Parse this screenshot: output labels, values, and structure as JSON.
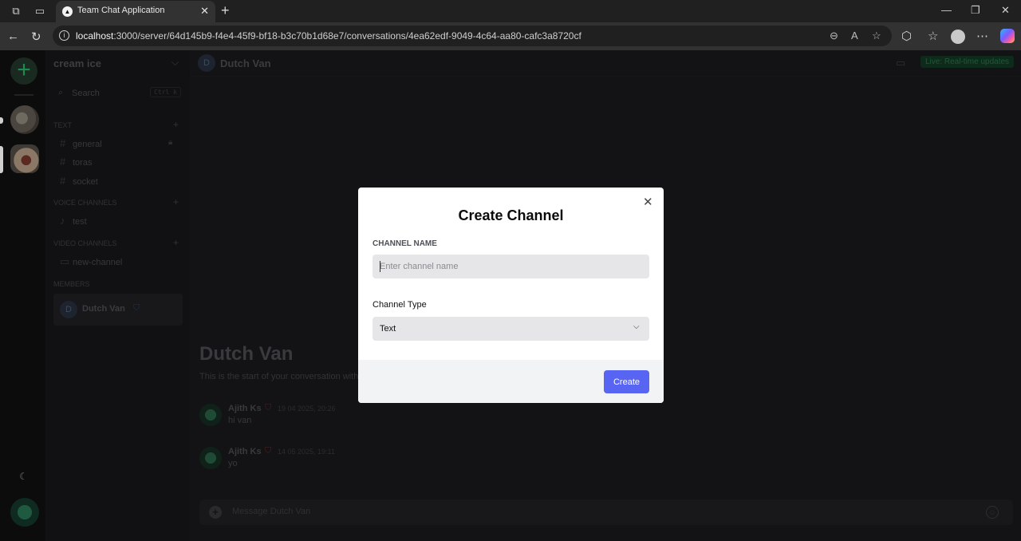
{
  "browser": {
    "tab_title": "Team Chat Application",
    "url_host": "localhost",
    "url_rest": ":3000/server/64d145b9-f4e4-45f9-bf18-b3c70b1d68e7/conversations/4ea62edf-9049-4c64-aa80-cafc3a8720cf"
  },
  "sidebar": {
    "server_name": "cream ice",
    "search_label": "Search",
    "search_shortcut": "Ctrl k",
    "sections": {
      "text": "TEXT",
      "voice": "VOICE CHANNELS",
      "video": "VIDEO CHANNELS",
      "members": "MEMBERS"
    },
    "text_channels": [
      "general",
      "toras",
      "socket"
    ],
    "voice_channels": [
      "test"
    ],
    "video_channels": [
      "new-channel"
    ],
    "members": [
      {
        "initial": "D",
        "name": "Dutch Van"
      }
    ]
  },
  "chat": {
    "header_initial": "D",
    "header_title": "Dutch Van",
    "live_badge": "Live: Real-time updates",
    "welcome_title": "Dutch Van",
    "welcome_sub": "This is the start of your conversation with",
    "messages": [
      {
        "author": "Ajith Ks",
        "time": "19 04 2025, 20:26",
        "text": "hi van"
      },
      {
        "author": "Ajith Ks",
        "time": "14 05 2025, 19:11",
        "text": "yo"
      }
    ],
    "composer_placeholder": "Message Dutch Van"
  },
  "modal": {
    "title": "Create Channel",
    "name_label": "CHANNEL NAME",
    "name_placeholder": "Enter channel name",
    "name_value": "",
    "type_label": "Channel Type",
    "type_value": "Text",
    "create_label": "Create"
  },
  "colors": {
    "accent": "#5865f2",
    "live_badge_bg": "#0e2a1b"
  }
}
